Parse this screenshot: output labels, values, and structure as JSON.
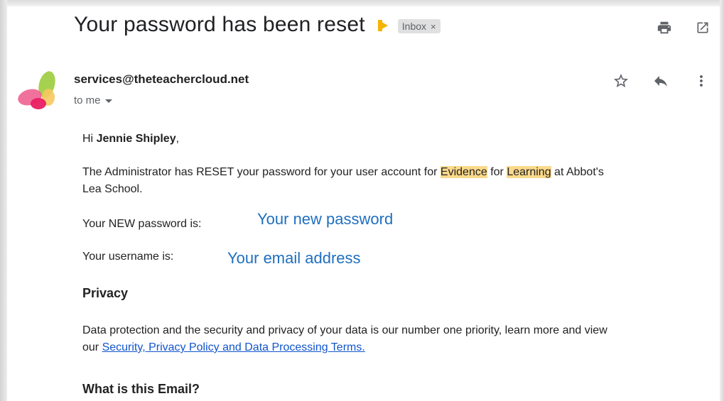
{
  "email": {
    "subject": "Your password has been reset",
    "label": "Inbox",
    "label_remove": "×",
    "sender": "services@theteachercloud.net",
    "recipient": "to me"
  },
  "body": {
    "greeting_prefix": "Hi ",
    "greeting_name": "Jennie Shipley",
    "greeting_suffix": ",",
    "para1_a": "The Administrator has RESET your password for your user account for ",
    "para1_hl1": "Evidence",
    "para1_b": " for ",
    "para1_hl2": "Learning",
    "para1_c": " at Abbot's",
    "para1_line2": "Lea School.",
    "new_password_label": "Your NEW password is:",
    "username_label": "Your username is:",
    "privacy_heading": "Privacy",
    "privacy_line1": "Data protection and the security and privacy of your data is our number one priority, learn more and view",
    "privacy_line2_prefix": "our ",
    "privacy_link": "Security, Privacy Policy and Data Processing Terms.",
    "what_heading": "What is this Email?"
  },
  "overlays": {
    "new_password": "Your new password",
    "email_address": "Your email address"
  },
  "icons": {
    "importance": "importance-marker-icon",
    "print": "print-icon",
    "open_new_window": "open-in-new-window-icon",
    "star": "star-icon",
    "reply": "reply-icon",
    "more": "more-vertical-icon",
    "dropdown": "chevron-down-icon"
  },
  "colors": {
    "highlight": "#fbd98a",
    "overlay_text": "#1f6fbf",
    "link": "#1155cc",
    "importance": "#f4b400"
  }
}
